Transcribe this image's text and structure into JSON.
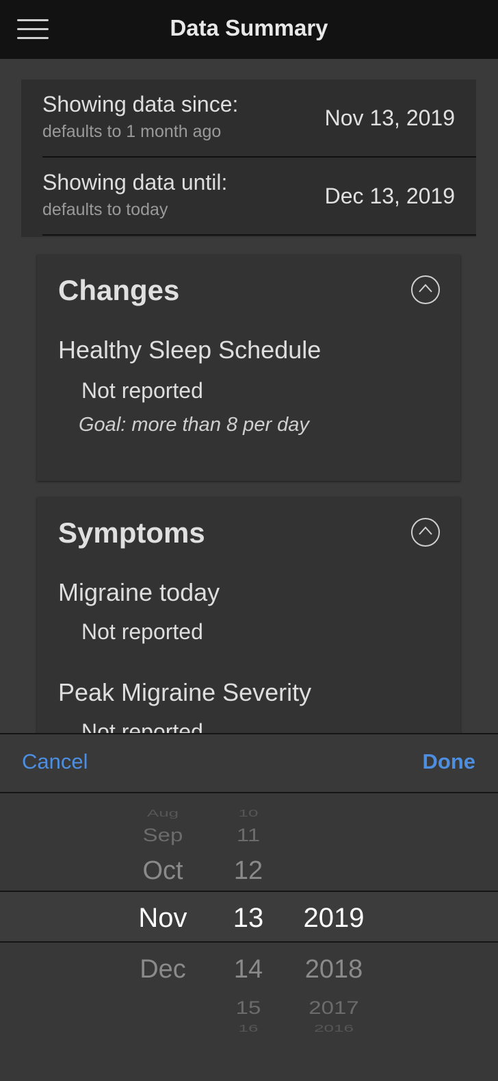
{
  "nav": {
    "title": "Data Summary",
    "menu_icon": "hamburger-menu-icon"
  },
  "date_range": {
    "since": {
      "label": "Showing data since:",
      "sublabel": "defaults to 1 month ago",
      "value": "Nov 13, 2019"
    },
    "until": {
      "label": "Showing data until:",
      "sublabel": "defaults to today",
      "value": "Dec 13, 2019"
    }
  },
  "cards": {
    "changes": {
      "title": "Changes",
      "collapse_icon": "chevron-up-circle-icon",
      "items": [
        {
          "name": "Healthy Sleep Schedule",
          "status": "Not reported",
          "goal": "Goal: more than 8 per day"
        }
      ]
    },
    "symptoms": {
      "title": "Symptoms",
      "collapse_icon": "chevron-up-circle-icon",
      "items": [
        {
          "name": "Migraine today",
          "status": "Not reported"
        },
        {
          "name": "Peak Migraine Severity",
          "status": "Not reported"
        }
      ]
    }
  },
  "picker": {
    "cancel_label": "Cancel",
    "done_label": "Done",
    "months": {
      "above": [
        "Aug",
        "Sep",
        "Oct"
      ],
      "selected": "Nov",
      "below": [
        "Dec"
      ]
    },
    "days": {
      "above": [
        "10",
        "11",
        "12"
      ],
      "selected": "13",
      "below": [
        "14",
        "15",
        "16"
      ]
    },
    "years": {
      "selected": "2019",
      "below": [
        "2018",
        "2017",
        "2016"
      ]
    }
  },
  "colors": {
    "accent": "#4d8ee0",
    "nav_background": "#121212",
    "page_background": "#3a3a3a"
  }
}
